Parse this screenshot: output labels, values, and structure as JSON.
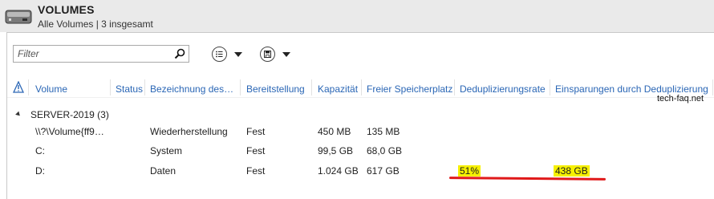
{
  "header": {
    "title": "VOLUMES",
    "subtitle": "Alle Volumes | 3 insgesamt"
  },
  "filter": {
    "placeholder": "Filter",
    "value": ""
  },
  "toolbar": {
    "icons": [
      "list-view-icon",
      "save-icon"
    ]
  },
  "table": {
    "columns": [
      "Volume",
      "Status",
      "Bezeichnung des…",
      "Bereitstellung",
      "Kapazität",
      "Freier Speicherplatz",
      "Deduplizierungsrate",
      "Einsparungen durch Deduplizierung"
    ],
    "group": "SERVER-2019 (3)",
    "rows": [
      {
        "volume": "\\\\?\\Volume{ff9…",
        "status": "",
        "label": "Wiederherstellung",
        "provisioning": "Fest",
        "capacity": "450 MB",
        "free": "135 MB",
        "dedup_rate": "",
        "savings": ""
      },
      {
        "volume": "C:",
        "status": "",
        "label": "System",
        "provisioning": "Fest",
        "capacity": "99,5 GB",
        "free": "68,0 GB",
        "dedup_rate": "",
        "savings": ""
      },
      {
        "volume": "D:",
        "status": "",
        "label": "Daten",
        "provisioning": "Fest",
        "capacity": "1.024 GB",
        "free": "617 GB",
        "dedup_rate": "51%",
        "savings": "438 GB"
      }
    ]
  },
  "watermark": "tech-faq.net",
  "colors": {
    "header_bg": "#eaeaea",
    "column_header_text": "#2a66b5",
    "highlight": "#f6f000",
    "underline": "#e0191a"
  }
}
